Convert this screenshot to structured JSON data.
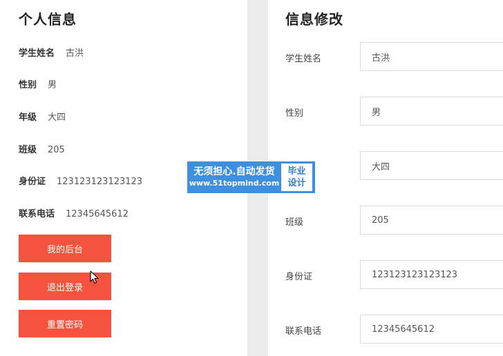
{
  "profile": {
    "title": "个人信息",
    "rows": [
      {
        "key": "学生姓名",
        "value": "古洪"
      },
      {
        "key": "性别",
        "value": "男"
      },
      {
        "key": "年级",
        "value": "大四"
      },
      {
        "key": "班级",
        "value": "205"
      },
      {
        "key": "身份证",
        "value": "123123123123123"
      },
      {
        "key": "联系电话",
        "value": "12345645612"
      }
    ],
    "buttons": {
      "backend": "我的后台",
      "logout": "退出登录",
      "reset_password": "重置密码"
    }
  },
  "edit": {
    "title": "信息修改",
    "fields": [
      {
        "label": "学生姓名",
        "value": "古洪"
      },
      {
        "label": "性别",
        "value": "男"
      },
      {
        "label": "",
        "value": "大四"
      },
      {
        "label": "班级",
        "value": "205"
      },
      {
        "label": "身份证",
        "value": "123123123123123"
      },
      {
        "label": "联系电话",
        "value": "12345645612"
      }
    ]
  },
  "watermark": {
    "line1": "无须担心.自动发货",
    "line2": "www.51topmind.com",
    "badge1": "毕业",
    "badge2": "设计"
  },
  "colors": {
    "button": "#f5533d",
    "watermark": "#3f8fe0"
  }
}
